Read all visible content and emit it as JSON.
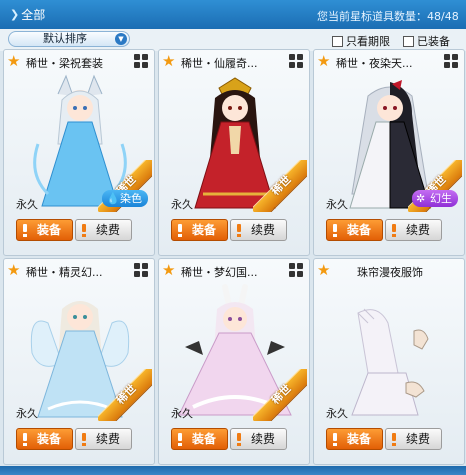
{
  "header": {
    "all_tab": "全部",
    "count_text": "您当前星标道具数量：48/48"
  },
  "filters": {
    "sort_value": "默认排序",
    "expiring_label": "只看期限",
    "equipped_label": "已装备"
  },
  "buttons": {
    "equip": "装备",
    "renew": "续费"
  },
  "ribbon_text": "稀世",
  "items": [
    {
      "name": "稀世・梁祝套装",
      "duration": "永久",
      "badge": "染色",
      "badge_type": "dye",
      "outfit_color": "#6ac3f2"
    },
    {
      "name": "稀世・仙履奇...",
      "duration": "永久",
      "badge": "",
      "badge_type": "",
      "outfit_color": "#c4222a"
    },
    {
      "name": "稀世・夜染天...",
      "duration": "永久",
      "badge": "幻生",
      "badge_type": "fantasy",
      "outfit_color": "#2a2a35"
    },
    {
      "name": "稀世・精灵幻...",
      "duration": "永久",
      "badge": "",
      "badge_type": "",
      "outfit_color": "#bfe2f5"
    },
    {
      "name": "稀世・梦幻国...",
      "duration": "永久",
      "badge": "",
      "badge_type": "",
      "outfit_color": "#f1d6ee"
    },
    {
      "name": "珠帘漫夜服饰",
      "duration": "永久",
      "badge": "",
      "badge_type": "",
      "outfit_color": "#f4f2f8"
    }
  ]
}
